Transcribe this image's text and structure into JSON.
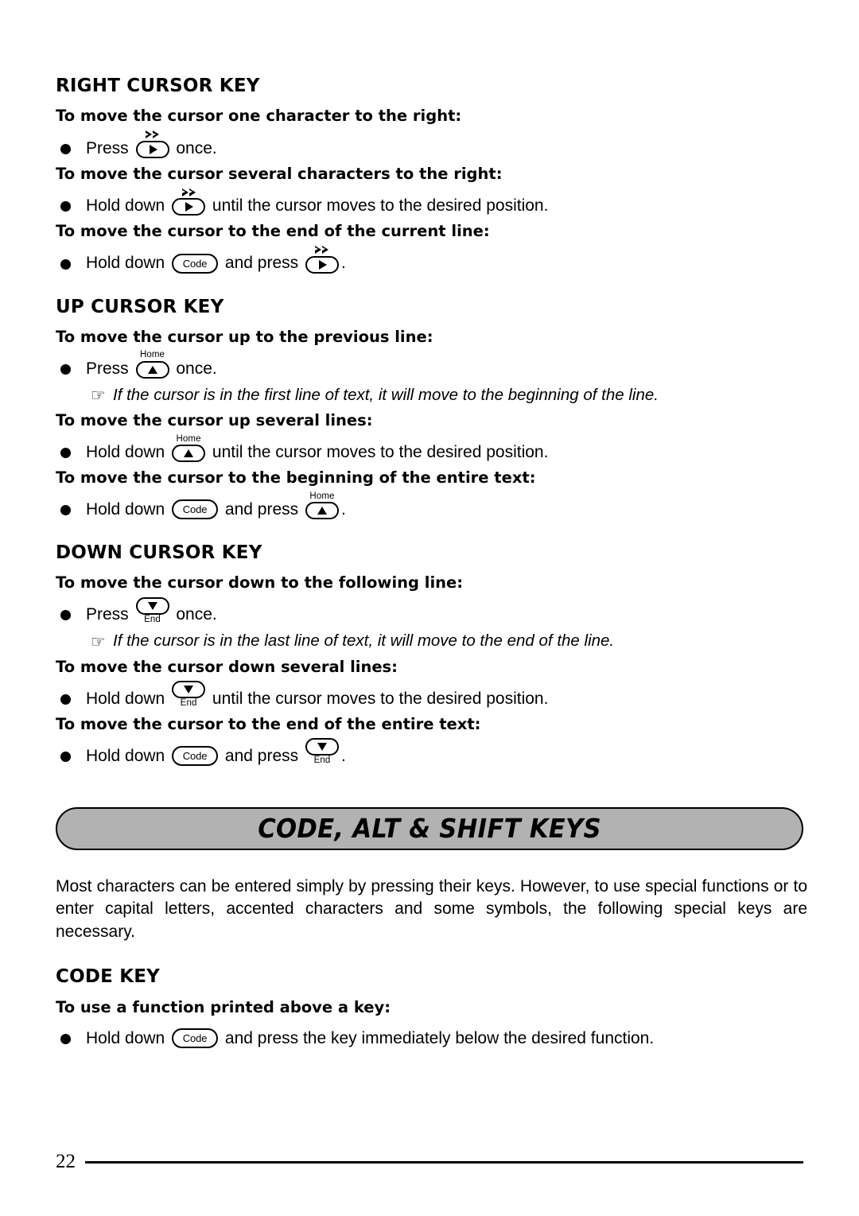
{
  "page": {
    "number": "22"
  },
  "sections": [
    {
      "heading": "RIGHT CURSOR KEY",
      "blocks": [
        {
          "subhead": "To move the cursor one character to the right:",
          "bullet_pre": "Press ",
          "key1": {
            "glyph": "right-arrow-key",
            "top_label": "fast-forward-marks",
            "bottom_label": ""
          },
          "bullet_post": " once."
        },
        {
          "subhead": "To move the cursor several characters to the right:",
          "bullet_pre": "Hold down ",
          "key1": {
            "glyph": "right-arrow-key",
            "top_label": "fast-forward-marks",
            "bottom_label": ""
          },
          "bullet_post": " until the cursor moves to the desired position."
        },
        {
          "subhead": "To move the cursor to the end of the current line:",
          "bullet_pre": "Hold down ",
          "key1": {
            "glyph": "code-key",
            "label": "Code"
          },
          "bullet_mid": " and press ",
          "key2": {
            "glyph": "right-arrow-key",
            "top_label": "fast-forward-marks",
            "bottom_label": ""
          },
          "bullet_post": "."
        }
      ]
    },
    {
      "heading": "UP CURSOR KEY",
      "blocks": [
        {
          "subhead": "To move the cursor up to the previous line:",
          "bullet_pre": "Press ",
          "key1": {
            "glyph": "up-arrow-key",
            "top_label": "Home",
            "bottom_label": ""
          },
          "bullet_post": " once.",
          "note": "If the cursor is in the first line of text, it will move to the beginning of the line."
        },
        {
          "subhead": "To move the cursor up several lines:",
          "bullet_pre": "Hold down ",
          "key1": {
            "glyph": "up-arrow-key",
            "top_label": "Home",
            "bottom_label": ""
          },
          "bullet_post": " until the cursor moves to the desired position."
        },
        {
          "subhead": "To move the cursor to the beginning of the entire text:",
          "bullet_pre": "Hold down ",
          "key1": {
            "glyph": "code-key",
            "label": "Code"
          },
          "bullet_mid": " and press ",
          "key2": {
            "glyph": "up-arrow-key",
            "top_label": "Home",
            "bottom_label": ""
          },
          "bullet_post": "."
        }
      ]
    },
    {
      "heading": "DOWN CURSOR KEY",
      "blocks": [
        {
          "subhead": "To move the cursor down to the following line:",
          "bullet_pre": "Press ",
          "key1": {
            "glyph": "down-arrow-key",
            "top_label": "",
            "bottom_label": "End"
          },
          "bullet_post": " once.",
          "note": "If the cursor is in the last line of text, it will move to the end of the line."
        },
        {
          "subhead": "To move the cursor down several lines:",
          "bullet_pre": "Hold down ",
          "key1": {
            "glyph": "down-arrow-key",
            "top_label": "",
            "bottom_label": "End"
          },
          "bullet_post": " until the cursor moves to the desired position."
        },
        {
          "subhead": "To move the cursor to the end of the entire text:",
          "bullet_pre": "Hold down ",
          "key1": {
            "glyph": "code-key",
            "label": "Code"
          },
          "bullet_mid": " and press ",
          "key2": {
            "glyph": "down-arrow-key",
            "top_label": "",
            "bottom_label": "End"
          },
          "bullet_post": "."
        }
      ]
    }
  ],
  "banner": {
    "title": "CODE, ALT & SHIFT KEYS",
    "fill_color": "#b2b2b2",
    "border_color": "#000000"
  },
  "intro_paragraph": "Most characters can be entered simply by pressing their keys. However, to use special functions or to enter capital letters, accented characters and some symbols, the following special keys are necessary.",
  "code_key_section": {
    "heading": "CODE KEY",
    "subhead": "To use a function printed above a key:",
    "bullet_pre": "Hold down ",
    "key_label": "Code",
    "bullet_post": " and press the key immediately below the desired function."
  }
}
